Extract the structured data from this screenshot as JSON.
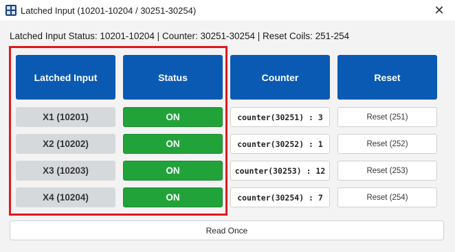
{
  "window": {
    "title": "Latched Input (10201-10204 / 30251-30254)",
    "close_glyph": "✕"
  },
  "status_line": "Latched Input Status: 10201-10204 | Counter: 30251-30254 | Reset Coils: 251-254",
  "headers": {
    "input": "Latched Input",
    "status": "Status",
    "counter": "Counter",
    "reset": "Reset"
  },
  "rows": [
    {
      "input": "X1 (10201)",
      "status": "ON",
      "counter": "counter(30251) : 3",
      "reset": "Reset (251)"
    },
    {
      "input": "X2 (10202)",
      "status": "ON",
      "counter": "counter(30252) : 1",
      "reset": "Reset (252)"
    },
    {
      "input": "X3 (10203)",
      "status": "ON",
      "counter": "counter(30253) : 12",
      "reset": "Reset (253)"
    },
    {
      "input": "X4 (10204)",
      "status": "ON",
      "counter": "counter(30254) : 7",
      "reset": "Reset (254)"
    }
  ],
  "read_once_label": "Read Once",
  "colors": {
    "header_bg": "#0a5ab4",
    "on_bg": "#22a33a",
    "highlight_border": "#e0161e"
  }
}
